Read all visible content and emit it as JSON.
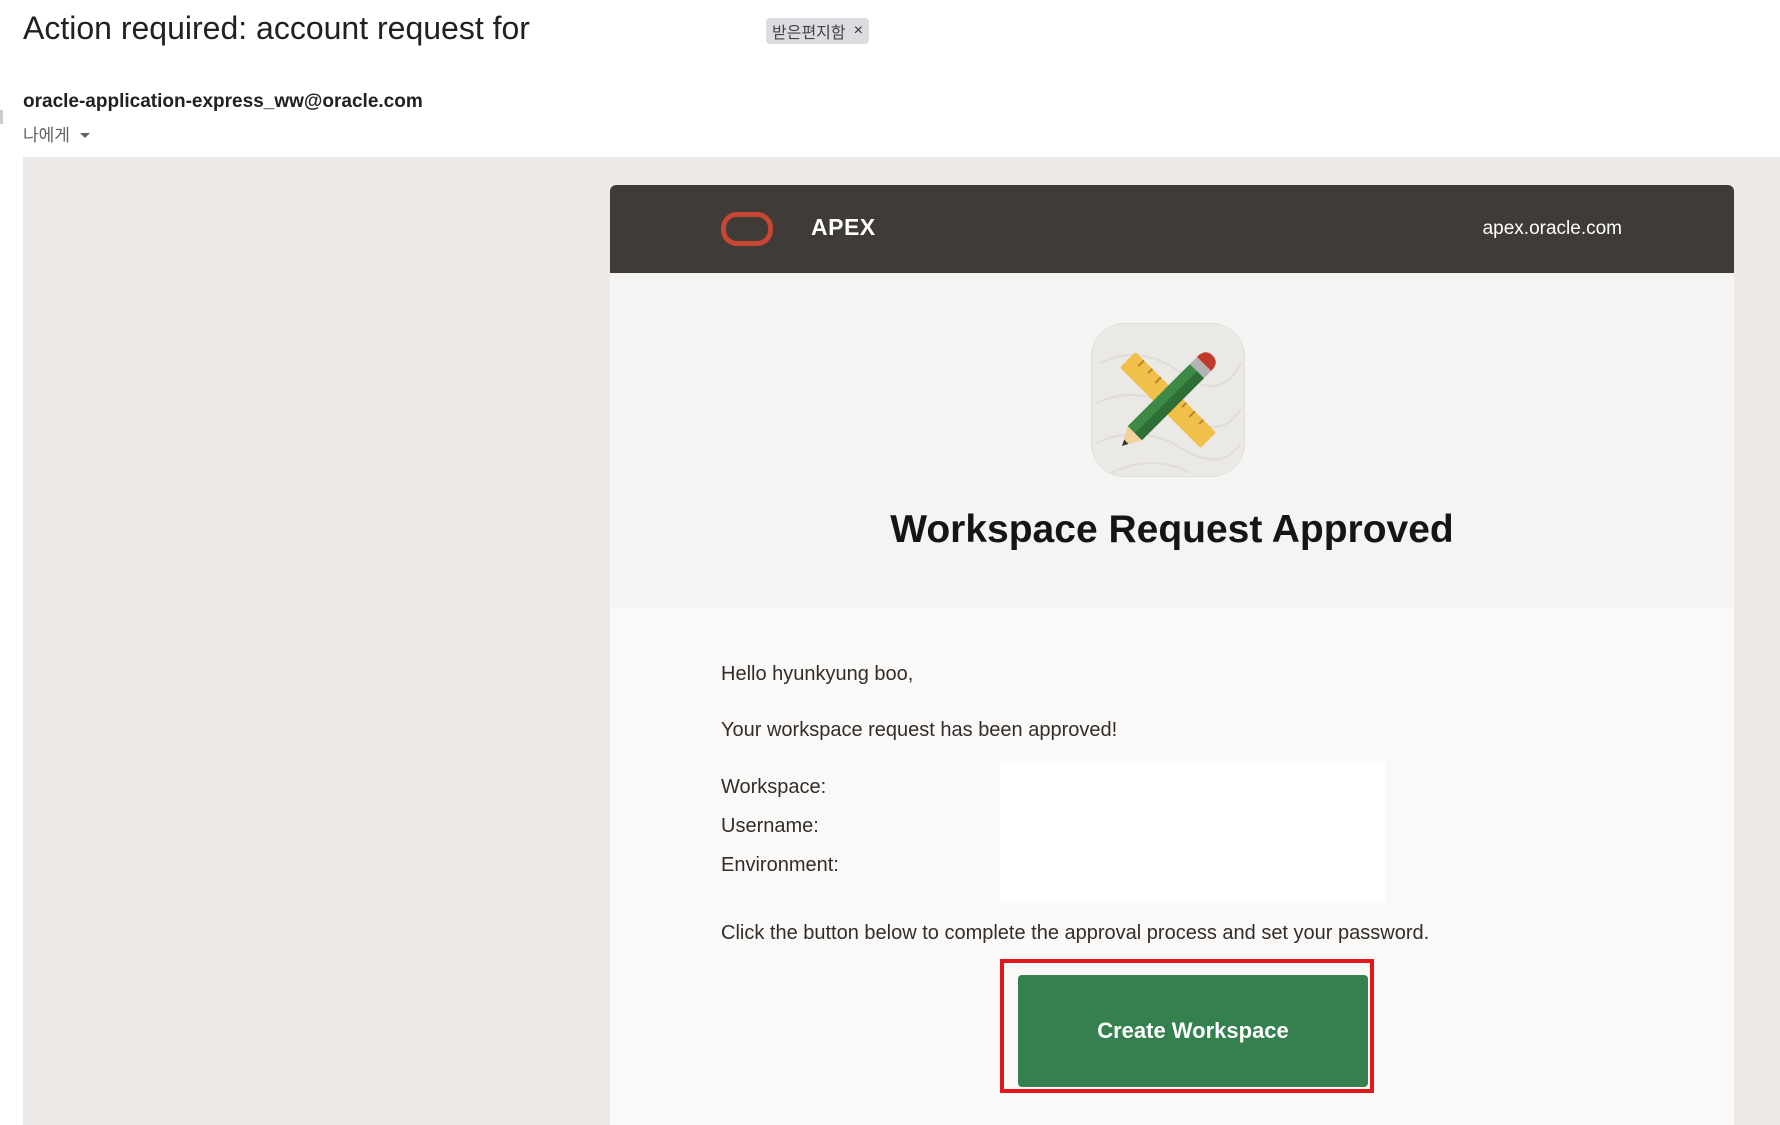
{
  "email": {
    "subject": "Action required: account request for",
    "label_chip": "받은편지함",
    "label_close": "×",
    "sender": "oracle-application-express_ww@oracle.com",
    "recipient": "나에게"
  },
  "card": {
    "brand_name": "APEX",
    "brand_domain": "apex.oracle.com",
    "hero_title": "Workspace Request Approved",
    "greeting": "Hello hyunkyung boo,",
    "approved_message": "Your workspace request has been approved!",
    "details": [
      {
        "label": "Workspace:",
        "value": ""
      },
      {
        "label": "Username:",
        "value": ""
      },
      {
        "label": "Environment:",
        "value": ""
      }
    ],
    "instruction": "Click the button below to complete the approval process and set your password.",
    "button_label": "Create Workspace"
  },
  "colors": {
    "header_bg": "#3f3b37",
    "oracle_red": "#c74634",
    "button_green": "#35804f",
    "highlight_red": "#e3161b",
    "mail_bg": "#ede9e6"
  },
  "icons": {
    "oracle_logo": "oracle-logo-icon",
    "app_icon": "pencil-ruler-icon",
    "caret": "chevron-down-icon"
  }
}
